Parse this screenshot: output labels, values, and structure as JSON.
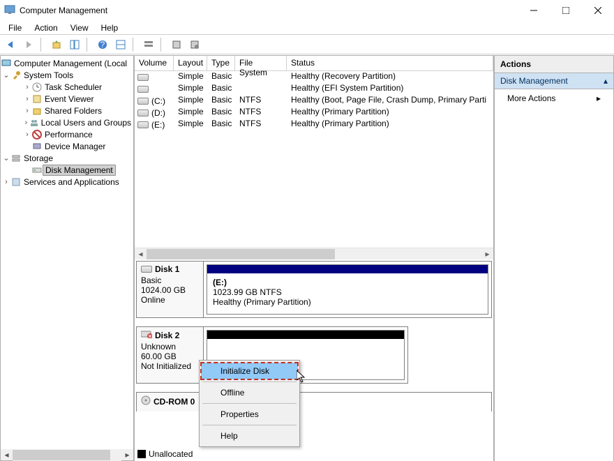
{
  "window": {
    "title": "Computer Management"
  },
  "menubar": [
    "File",
    "Action",
    "View",
    "Help"
  ],
  "tree": {
    "root": "Computer Management (Local",
    "system_tools": "System Tools",
    "task_scheduler": "Task Scheduler",
    "event_viewer": "Event Viewer",
    "shared_folders": "Shared Folders",
    "local_users": "Local Users and Groups",
    "performance": "Performance",
    "device_manager": "Device Manager",
    "storage": "Storage",
    "disk_management": "Disk Management",
    "services_apps": "Services and Applications"
  },
  "vol_columns": {
    "volume": "Volume",
    "layout": "Layout",
    "type": "Type",
    "fs": "File System",
    "status": "Status"
  },
  "volumes": [
    {
      "name": "",
      "layout": "Simple",
      "type": "Basic",
      "fs": "",
      "status": "Healthy (Recovery Partition)"
    },
    {
      "name": "",
      "layout": "Simple",
      "type": "Basic",
      "fs": "",
      "status": "Healthy (EFI System Partition)"
    },
    {
      "name": "(C:)",
      "layout": "Simple",
      "type": "Basic",
      "fs": "NTFS",
      "status": "Healthy (Boot, Page File, Crash Dump, Primary Parti"
    },
    {
      "name": "(D:)",
      "layout": "Simple",
      "type": "Basic",
      "fs": "NTFS",
      "status": "Healthy (Primary Partition)"
    },
    {
      "name": "(E:)",
      "layout": "Simple",
      "type": "Basic",
      "fs": "NTFS",
      "status": "Healthy (Primary Partition)"
    }
  ],
  "disks": {
    "d1": {
      "title": "Disk 1",
      "type": "Basic",
      "size": "1024.00 GB",
      "state": "Online",
      "part_letter": "(E:)",
      "part_size": "1023.99 GB NTFS",
      "part_status": "Healthy (Primary Partition)"
    },
    "d2": {
      "title": "Disk 2",
      "type": "Unknown",
      "size": "60.00 GB",
      "state": "Not Initialized"
    },
    "cd": {
      "title": "CD-ROM 0"
    }
  },
  "legend": {
    "unallocated": "Unallocated"
  },
  "actions": {
    "head": "Actions",
    "cat": "Disk Management",
    "more": "More Actions"
  },
  "context": {
    "init": "Initialize Disk",
    "offline": "Offline",
    "props": "Properties",
    "help": "Help"
  }
}
